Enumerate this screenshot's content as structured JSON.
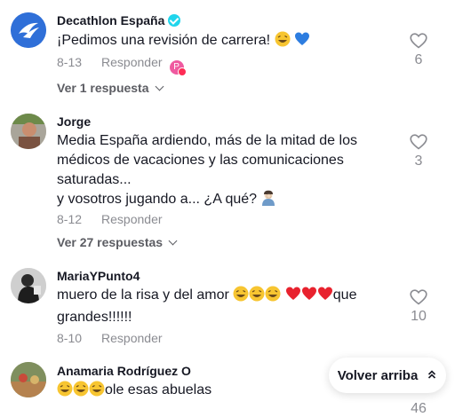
{
  "comments": [
    {
      "username": "Decathlon España",
      "verified": true,
      "lines": [
        "¡Pedimos una revisión de carrera!"
      ],
      "date": "8-13",
      "reply_label": "Responder",
      "creator_badge": "P",
      "likes": "6",
      "view_replies": "Ver 1 respuesta"
    },
    {
      "username": "Jorge",
      "lines": [
        "Media España ardiendo, más de la mitad de los",
        "médicos de vacaciones y las comunicaciones",
        "saturadas...",
        "y vosotros jugando a... ¿A qué?"
      ],
      "date": "8-12",
      "reply_label": "Responder",
      "likes": "3",
      "view_replies": "Ver 27 respuestas"
    },
    {
      "username": "MariaYPunto4",
      "lines": [
        "muero de la risa y del amor",
        "que",
        "grandes!!!!!!"
      ],
      "date": "8-10",
      "reply_label": "Responder",
      "likes": "10"
    },
    {
      "username": "Anamaria Rodríguez O",
      "lines": [
        "ole esas abuelas"
      ],
      "likes": "46"
    }
  ],
  "back_to_top": "Volver arriba",
  "colors": {
    "brand_blue": "#2f6fd8",
    "heart_red": "#e8222e",
    "meta_gray": "#8a8b91"
  }
}
